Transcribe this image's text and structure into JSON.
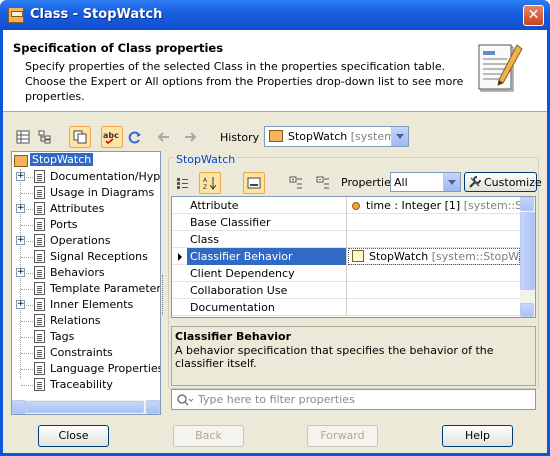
{
  "window": {
    "title": "Class - StopWatch"
  },
  "header": {
    "title": "Specification of Class properties",
    "description": "Specify properties of the selected Class in the properties specification table. Choose the Expert or All options from the Properties drop-down list to see more properties."
  },
  "toolbar": {
    "history_label": "History :",
    "history_value": "StopWatch",
    "history_scope": "[system]"
  },
  "tree": {
    "root": "StopWatch",
    "items": [
      {
        "label": "Documentation/Hyperl",
        "expandable": true
      },
      {
        "label": "Usage in Diagrams",
        "expandable": false
      },
      {
        "label": "Attributes",
        "expandable": true
      },
      {
        "label": "Ports",
        "expandable": false
      },
      {
        "label": "Operations",
        "expandable": true
      },
      {
        "label": "Signal Receptions",
        "expandable": false
      },
      {
        "label": "Behaviors",
        "expandable": true
      },
      {
        "label": "Template Parameters",
        "expandable": false
      },
      {
        "label": "Inner Elements",
        "expandable": true
      },
      {
        "label": "Relations",
        "expandable": false
      },
      {
        "label": "Tags",
        "expandable": false
      },
      {
        "label": "Constraints",
        "expandable": false
      },
      {
        "label": "Language Properties",
        "expandable": false
      },
      {
        "label": "Traceability",
        "expandable": false
      }
    ]
  },
  "panel": {
    "group_title": "StopWatch",
    "properties_label": "Properties:",
    "properties_value": "All",
    "customize_label": "Customize"
  },
  "grid": {
    "rows": [
      {
        "name": "Attribute",
        "value": "time : Integer [1]",
        "value_gray": " [system::StopWatch]",
        "selected": false
      },
      {
        "name": "Base Classifier",
        "value": "",
        "value_gray": "",
        "selected": false
      },
      {
        "name": "Class",
        "value": "",
        "value_gray": "",
        "selected": false
      },
      {
        "name": "Classifier Behavior",
        "value": "StopWatch",
        "value_gray": " [system::StopW...",
        "selected": true
      },
      {
        "name": "Client Dependency",
        "value": "",
        "value_gray": "",
        "selected": false
      },
      {
        "name": "Collaboration Use",
        "value": "",
        "value_gray": "",
        "selected": false
      },
      {
        "name": "Documentation",
        "value": "",
        "value_gray": "",
        "selected": false
      }
    ]
  },
  "description": {
    "title": "Classifier Behavior",
    "text": "A behavior specification that specifies the behavior of the classifier itself."
  },
  "filter": {
    "placeholder": "Type here to filter properties"
  },
  "buttons": {
    "close": "Close",
    "back": "Back",
    "forward": "Forward",
    "help": "Help"
  }
}
